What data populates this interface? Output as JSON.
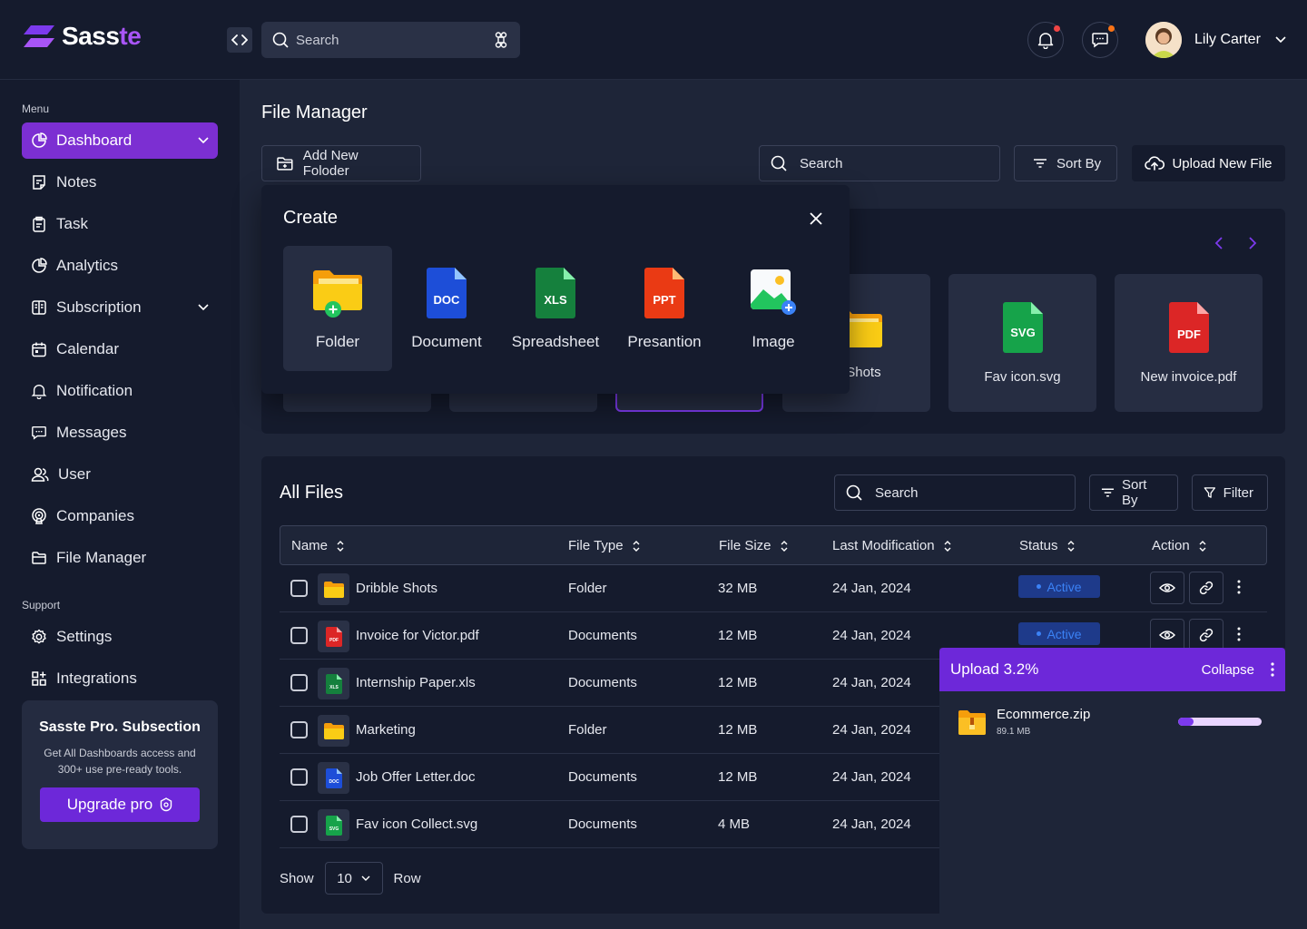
{
  "app": {
    "name_part1": "Sass",
    "name_part2": "te"
  },
  "header": {
    "search_placeholder": "Search",
    "user_name": "Lily Carter"
  },
  "sidebar": {
    "menu_heading": "Menu",
    "items": [
      {
        "label": "Dashboard",
        "icon": "pie-chart-icon"
      },
      {
        "label": "Notes",
        "icon": "note-icon"
      },
      {
        "label": "Task",
        "icon": "task-icon"
      },
      {
        "label": "Analytics",
        "icon": "pie-chart-icon"
      },
      {
        "label": "Subscription",
        "icon": "subscription-icon"
      },
      {
        "label": "Calendar",
        "icon": "calendar-icon"
      },
      {
        "label": "Notification",
        "icon": "bell-icon"
      },
      {
        "label": "Messages",
        "icon": "chat-icon"
      },
      {
        "label": "User",
        "icon": "users-icon"
      },
      {
        "label": "Companies",
        "icon": "companies-icon"
      },
      {
        "label": "File Manager",
        "icon": "folder-icon"
      }
    ],
    "support_heading": "Support",
    "support_items": [
      {
        "label": "Settings",
        "icon": "gear-icon"
      },
      {
        "label": "Integrations",
        "icon": "integrations-icon"
      }
    ],
    "promo": {
      "title": "Sasste Pro. Subsection",
      "description": "Get All Dashboards access and 300+ use pre-ready tools.",
      "button": "Upgrade pro"
    }
  },
  "main": {
    "title": "File Manager",
    "add_folder": "Add New Foloder",
    "search_placeholder": "Search",
    "sort_by": "Sort By",
    "upload_new": "Upload New File",
    "recent_cards": [
      {
        "label": "le Shots"
      },
      {
        "label": "Fav icon.svg",
        "badge": "SVG"
      },
      {
        "label": "New invoice.pdf",
        "badge": "PDF"
      }
    ]
  },
  "create_menu": {
    "title": "Create",
    "items": [
      {
        "label": "Folder"
      },
      {
        "label": "Document",
        "badge": "DOC"
      },
      {
        "label": "Spreadsheet",
        "badge": "XLS"
      },
      {
        "label": "Presantion",
        "badge": "PPT"
      },
      {
        "label": "Image"
      }
    ]
  },
  "all_files": {
    "title": "All Files",
    "search_placeholder": "Search",
    "sort_by": "Sort By",
    "filter": "Filter",
    "columns": [
      "Name",
      "File Type",
      "File Size",
      "Last Modification",
      "Status",
      "Action"
    ],
    "rows": [
      {
        "name": "Dribble Shots",
        "type": "Folder",
        "size": "32 MB",
        "modified": "24 Jan, 2024",
        "status": "Active",
        "icon": "folder-icon"
      },
      {
        "name": "Invoice for Victor.pdf",
        "type": "Documents",
        "size": "12 MB",
        "modified": "24 Jan, 2024",
        "status": "Active",
        "icon": "pdf-icon"
      },
      {
        "name": "Internship Paper.xls",
        "type": "Documents",
        "size": "12 MB",
        "modified": "24 Jan, 2024",
        "status": "",
        "icon": "xls-icon"
      },
      {
        "name": "Marketing",
        "type": "Folder",
        "size": "12 MB",
        "modified": "24 Jan, 2024",
        "status": "",
        "icon": "folder-icon"
      },
      {
        "name": "Job Offer Letter.doc",
        "type": "Documents",
        "size": "12 MB",
        "modified": "24 Jan, 2024",
        "status": "",
        "icon": "doc-icon"
      },
      {
        "name": "Fav icon Collect.svg",
        "type": "Documents",
        "size": "4 MB",
        "modified": "24 Jan, 2024",
        "status": "",
        "icon": "svg-icon"
      }
    ],
    "show_label": "Show",
    "rows_value": "10",
    "row_label": "Row"
  },
  "upload": {
    "title": "Upload 3.2%",
    "collapse": "Collapse",
    "file_name": "Ecommerce.zip",
    "file_size": "89.1 MB",
    "progress_fraction": 0.18
  },
  "colors": {
    "accent": "#7c2fd2",
    "background": "#151b2d",
    "panel": "#1e2538",
    "status_active": "#3b82f6"
  }
}
